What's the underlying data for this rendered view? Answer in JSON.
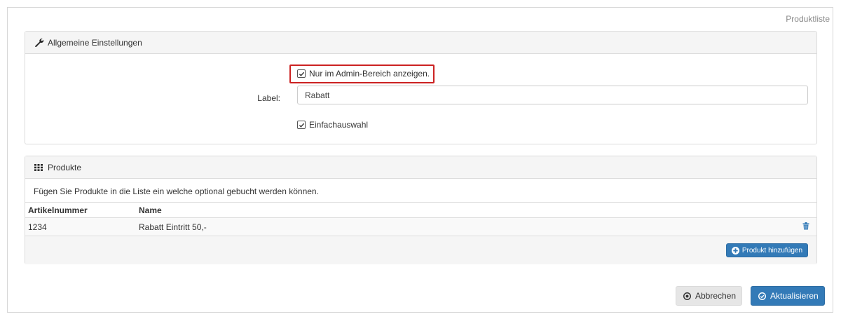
{
  "page": {
    "label": "Produktliste"
  },
  "settings": {
    "heading": "Allgemeine Einstellungen",
    "admin_only": {
      "label": "Nur im Admin-Bereich anzeigen.",
      "checked": true
    },
    "label_field": {
      "label": "Label:",
      "value": "Rabatt"
    },
    "single_select": {
      "label": "Einfachauswahl",
      "checked": true
    }
  },
  "products": {
    "heading": "Produkte",
    "intro": "Fügen Sie Produkte in die Liste ein welche optional gebucht werden können.",
    "columns": [
      "Artikelnummer",
      "Name"
    ],
    "rows": [
      {
        "article_no": "1234",
        "name": "Rabatt Eintritt 50,-"
      }
    ],
    "add_button": "Produkt hinzufügen"
  },
  "actions": {
    "cancel": "Abbrechen",
    "update": "Aktualisieren"
  },
  "colors": {
    "primary": "#337ab7",
    "highlight": "#cc2222",
    "panel_heading_bg": "#f5f5f5"
  }
}
